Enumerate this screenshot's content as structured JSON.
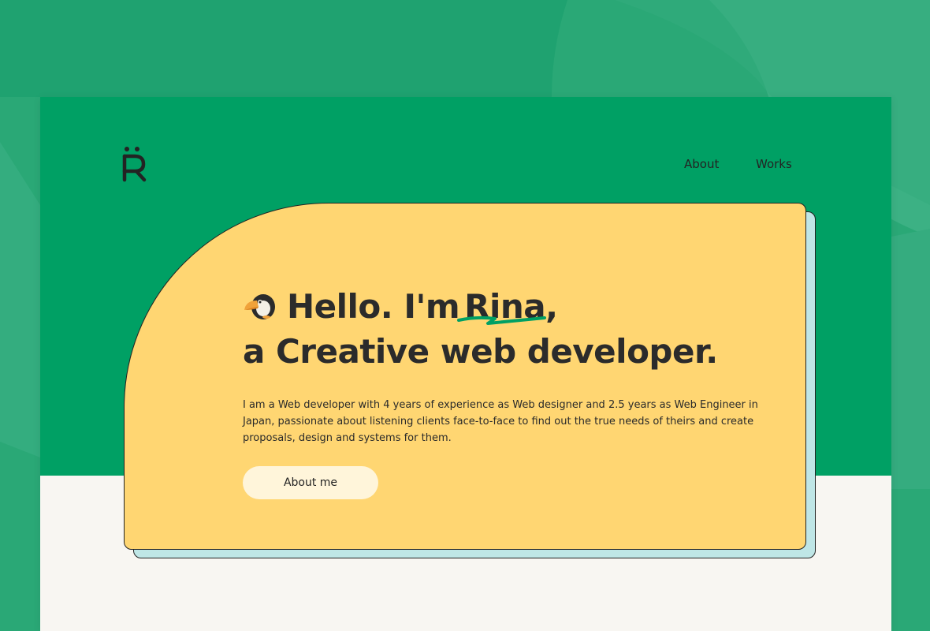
{
  "nav": {
    "about_label": "About",
    "works_label": "Works"
  },
  "logo": {
    "letter": "R"
  },
  "hero": {
    "emoji_icon": "toucan-icon",
    "greeting_prefix": "Hello. I'm",
    "name": "Rina",
    "greeting_suffix": ",",
    "title_line2": "a Creative web developer.",
    "intro": "I am a Web developer with 4 years of experience as Web designer and 2.5 years as Web Engineer in Japan, passionate about listening clients face-to-face to find out the true needs of theirs and create proposals, design and systems for them.",
    "button_label": "About me"
  },
  "colors": {
    "outer_background": "#2aa876",
    "header_green": "#00a064",
    "card_yellow": "#ffd672",
    "card_shadow": "#bfe6e6",
    "button_background": "#fff5da",
    "lower_background": "#f8f6f2"
  }
}
